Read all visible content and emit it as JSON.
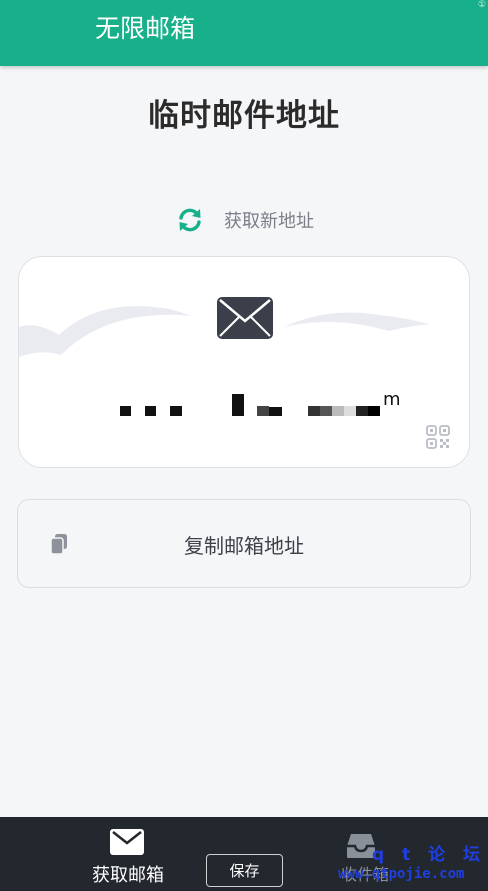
{
  "header": {
    "title": "无限邮箱",
    "corner_mark": "①"
  },
  "page_title": "临时邮件地址",
  "refresh": {
    "label": "获取新地址",
    "icon": "refresh-icon",
    "icon_color": "#17b08a"
  },
  "mail_card": {
    "icon": "envelope-icon",
    "address_suffix": "m",
    "address_note": "address obscured by pixelation",
    "qr_icon": "qr-code-icon"
  },
  "copy": {
    "label": "复制邮箱地址",
    "icon": "copy-icon"
  },
  "bottom_nav": {
    "mail_tab_label": "获取邮箱",
    "save_label": "保存",
    "inbox_tab_label": "收件箱"
  },
  "watermark": {
    "line1": "q t 论 坛",
    "line2": "www.qtpojie.com"
  },
  "colors": {
    "accent": "#17b08a",
    "bottom_bar": "#23272e",
    "background": "#f5f6f8",
    "watermark": "#1f3fe0"
  }
}
